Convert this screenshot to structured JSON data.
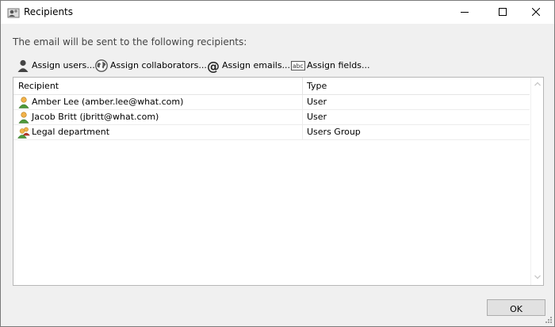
{
  "window": {
    "title": "Recipients",
    "icon": "recipients-icon"
  },
  "info_text": "The email will be sent to the following recipients:",
  "toolbar": {
    "assign_users": "Assign users...",
    "assign_collaborators": "Assign collaborators...",
    "assign_emails": "Assign emails...",
    "assign_fields": "Assign fields..."
  },
  "table": {
    "headers": {
      "recipient": "Recipient",
      "type": "Type"
    },
    "rows": [
      {
        "name": "Amber Lee (amber.lee@what.com)",
        "type": "User",
        "icon": "user-icon"
      },
      {
        "name": "Jacob Britt (jbritt@what.com)",
        "type": "User",
        "icon": "user-icon"
      },
      {
        "name": "Legal department",
        "type": "Users Group",
        "icon": "users-group-icon"
      }
    ]
  },
  "ok_label": "OK",
  "colors": {
    "title_bar": "#ffffff",
    "window_bg": "#f0f0f0",
    "user_icon_head": "#f2b24a",
    "user_icon_body": "#4e9a3a",
    "group_icon_second": "#c0392b"
  }
}
